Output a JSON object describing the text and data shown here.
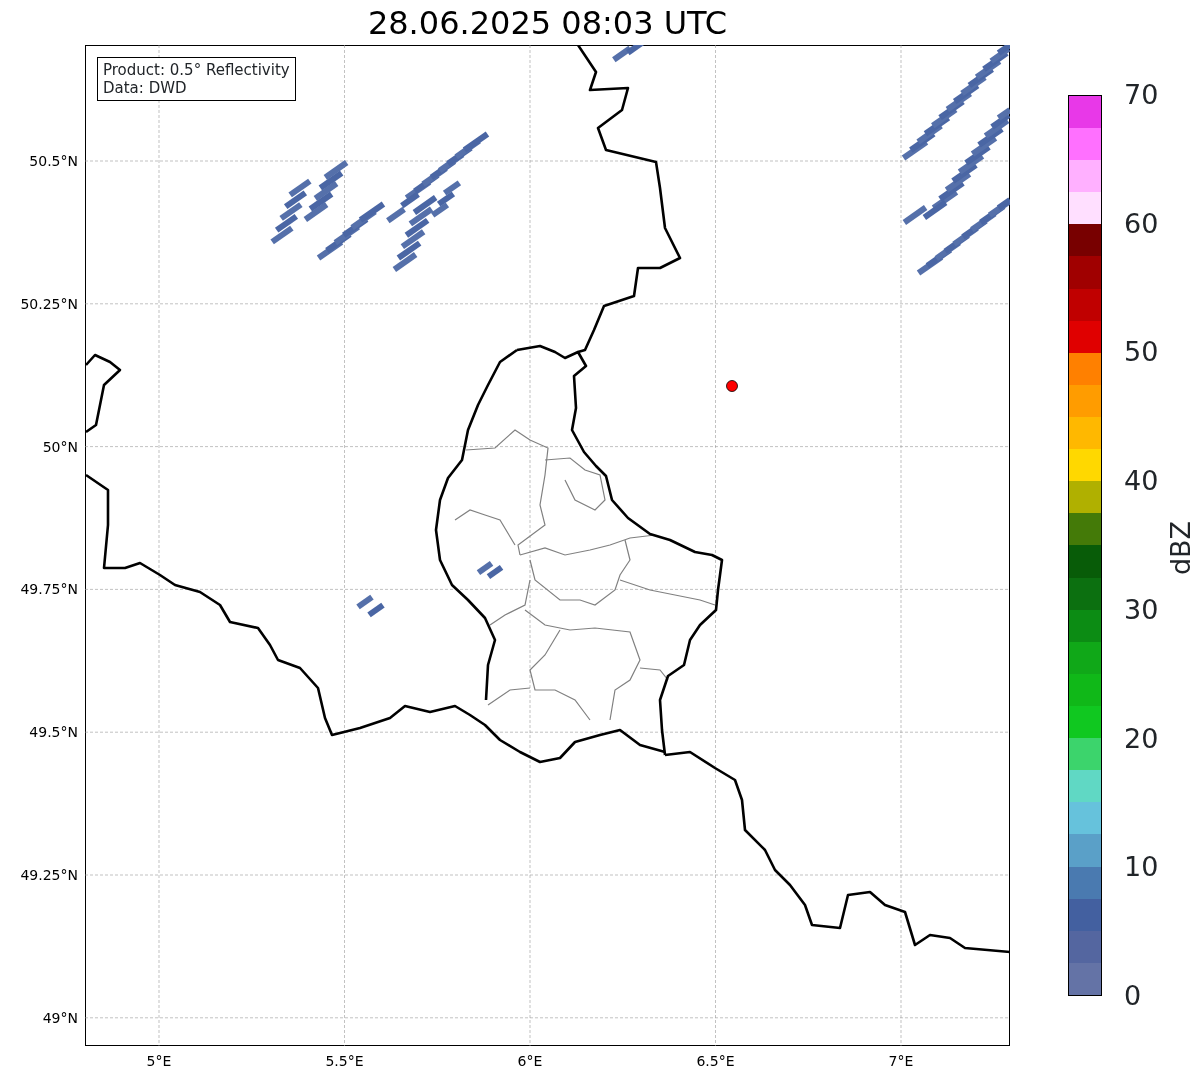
{
  "title": "28.06.2025 08:03 UTC",
  "info_box": {
    "lines": [
      "Product: 0.5° Reflectivity",
      "Data: DWD"
    ]
  },
  "map": {
    "y_ticks": [
      "50.5°N",
      "50.25°N",
      "50°N",
      "49.75°N",
      "49.5°N",
      "49.25°N",
      "49°N"
    ],
    "x_ticks": [
      "5°E",
      "5.5°E",
      "6°E",
      "6.5°E",
      "7°E"
    ]
  },
  "colorbar": {
    "label": "dBZ",
    "ticks": [
      "70",
      "60",
      "50",
      "40",
      "30",
      "20",
      "10",
      "0"
    ],
    "segments": [
      {
        "color": "#6473a6"
      },
      {
        "color": "#5466a0"
      },
      {
        "color": "#4360a0"
      },
      {
        "color": "#4a7ab0"
      },
      {
        "color": "#5aa0c8"
      },
      {
        "color": "#66c2dc"
      },
      {
        "color": "#60d8c4"
      },
      {
        "color": "#3cd46c"
      },
      {
        "color": "#10c820"
      },
      {
        "color": "#10b818"
      },
      {
        "color": "#10a818"
      },
      {
        "color": "#0c8c14"
      },
      {
        "color": "#0c7010"
      },
      {
        "color": "#085c08"
      },
      {
        "color": "#447a08"
      },
      {
        "color": "#b0b000"
      },
      {
        "color": "#ffd800"
      },
      {
        "color": "#ffb800"
      },
      {
        "color": "#ff9c00"
      },
      {
        "color": "#ff8000"
      },
      {
        "color": "#e00000"
      },
      {
        "color": "#c00000"
      },
      {
        "color": "#a00000"
      },
      {
        "color": "#780000"
      },
      {
        "color": "#ffdfff"
      },
      {
        "color": "#ffb0ff"
      },
      {
        "color": "#ff70ff"
      },
      {
        "color": "#e838e8"
      }
    ]
  }
}
